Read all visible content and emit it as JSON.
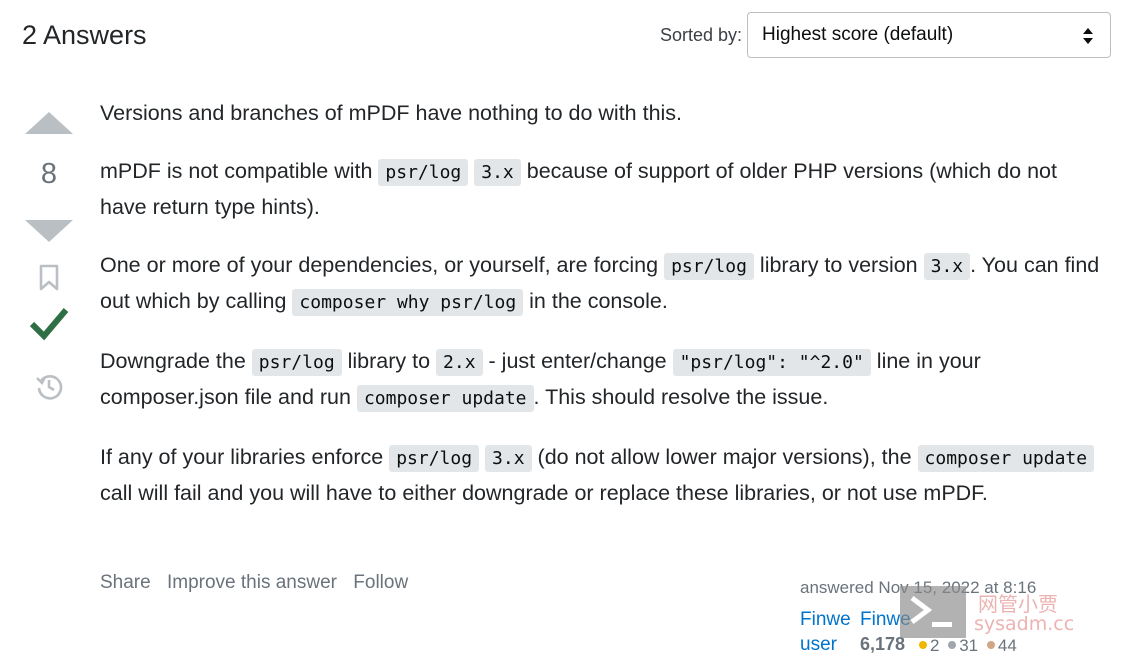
{
  "header": {
    "answers_title": "2 Answers",
    "sort_label": "Sorted by:",
    "sort_value": "Highest score (default)"
  },
  "vote": {
    "score": "8"
  },
  "post": {
    "p1": "Versions and branches of mPDF have nothing to do with this.",
    "p2_a": "mPDF is not compatible with ",
    "p2_code1": "psr/log",
    "p2_code2": "3.x",
    "p2_b": " because of support of older PHP versions (which do not have return type hints).",
    "p3_a": "One or more of your dependencies, or yourself, are forcing ",
    "p3_code1": "psr/log",
    "p3_b": " library to version ",
    "p3_code2": "3.x",
    "p3_c": ". You can find out which by calling ",
    "p3_code3": "composer why psr/log",
    "p3_d": " in the console.",
    "p4_a": "Downgrade the ",
    "p4_code1": "psr/log",
    "p4_b": " library to ",
    "p4_code2": "2.x",
    "p4_c": " - just enter/change ",
    "p4_code3": "\"psr/log\": \"^2.0\"",
    "p4_d": " line in your composer.json file and run ",
    "p4_code4": "composer update",
    "p4_e": ". This should resolve the issue.",
    "p5_a": "If any of your libraries enforce ",
    "p5_code1": "psr/log",
    "p5_code2": "3.x",
    "p5_b": " (do not allow lower major versions), the ",
    "p5_code3": "composer update",
    "p5_c": " call will fail and you will have to either downgrade or replace these libraries, or not use mPDF."
  },
  "menu": {
    "share": "Share",
    "improve": "Improve this answer",
    "follow": "Follow"
  },
  "user": {
    "answered": "answered Nov 15, 2022 at 8:16",
    "name_part1": "Finwe",
    "name_part1b": "user",
    "name_part2": "Finwe",
    "reputation": "6,178",
    "gold": "2",
    "silver": "31",
    "bronze": "44"
  },
  "watermark": {
    "line1": "网管小贾",
    "line2": "sysadm.cc"
  },
  "colors": {
    "link": "#0074cc",
    "accepted": "#2f6f44",
    "vote_arrow": "#babfc4",
    "code_bg": "#e3e6e8",
    "gold": "#f1b600",
    "silver": "#9fa6ad",
    "bronze": "#d1a684"
  }
}
